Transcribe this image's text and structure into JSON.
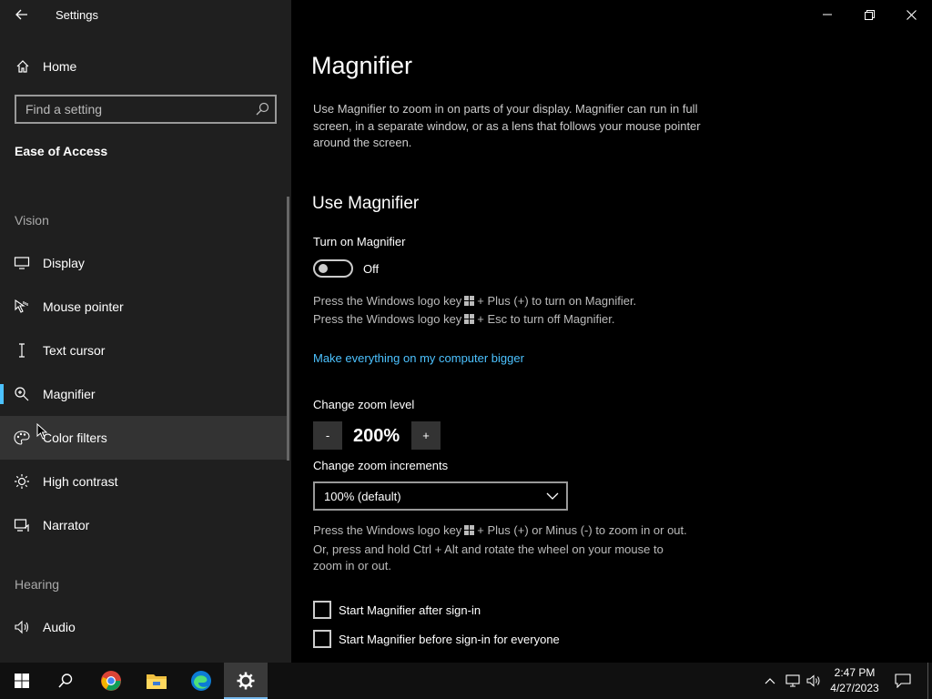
{
  "window": {
    "title": "Settings",
    "controls": [
      "minimize",
      "maximize",
      "close"
    ]
  },
  "sidebar": {
    "home_label": "Home",
    "search_placeholder": "Find a setting",
    "section_title": "Ease of Access",
    "groups": {
      "vision": "Vision",
      "hearing": "Hearing"
    },
    "items": [
      {
        "label": "Display",
        "icon": "monitor-icon"
      },
      {
        "label": "Mouse pointer",
        "icon": "mouse-pointer-icon"
      },
      {
        "label": "Text cursor",
        "icon": "text-cursor-icon"
      },
      {
        "label": "Magnifier",
        "icon": "magnifier-icon",
        "selected": true
      },
      {
        "label": "Color filters",
        "icon": "color-filters-icon"
      },
      {
        "label": "High contrast",
        "icon": "high-contrast-icon"
      },
      {
        "label": "Narrator",
        "icon": "narrator-icon"
      },
      {
        "label": "Audio",
        "icon": "audio-icon"
      }
    ]
  },
  "main": {
    "title": "Magnifier",
    "description": "Use Magnifier to zoom in on parts of your display. Magnifier can run in full screen, in a separate window, or as a lens that follows your mouse pointer around the screen.",
    "use_section": "Use Magnifier",
    "turn_on_label": "Turn on Magnifier",
    "toggle_state": "Off",
    "hint_on_prefix": "Press the Windows logo key",
    "hint_on_suffix": "+ Plus (+) to turn on Magnifier.",
    "hint_off_prefix": "Press the Windows logo key",
    "hint_off_suffix": "+ Esc to turn off Magnifier.",
    "link_text": "Make everything on my computer bigger",
    "zoom_level_label": "Change zoom level",
    "zoom_minus": "-",
    "zoom_value": "200%",
    "zoom_plus": "+",
    "zoom_increments_label": "Change zoom increments",
    "zoom_increments_value": "100% (default)",
    "zoom_hint_prefix": "Press the Windows logo key",
    "zoom_hint_suffix": "+ Plus (+) or Minus (-) to zoom in or out.",
    "zoom_hint_line2": "Or, press and hold Ctrl + Alt and rotate the wheel on your mouse to",
    "zoom_hint_line3": "zoom in or out.",
    "checkbox_after_signin": "Start Magnifier after sign-in",
    "checkbox_before_signin": "Start Magnifier before sign-in for everyone"
  },
  "taskbar": {
    "time": "2:47 PM",
    "date": "4/27/2023",
    "apps": [
      "start",
      "search",
      "chrome",
      "file-explorer",
      "edge",
      "settings"
    ],
    "accent": "#76b9ed"
  },
  "colors": {
    "sidebar_bg": "#1f1f1f",
    "main_bg": "#000000",
    "accent": "#4cc2ff"
  }
}
